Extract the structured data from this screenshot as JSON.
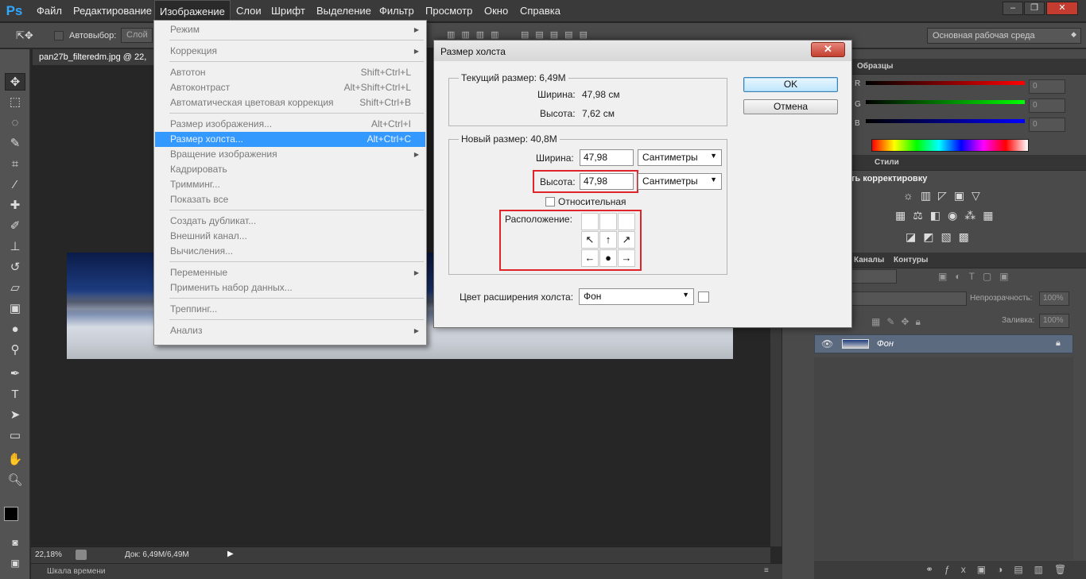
{
  "app": {
    "logo": "Ps"
  },
  "menubar": {
    "items": [
      "Файл",
      "Редактирование",
      "Изображение",
      "Слои",
      "Шрифт",
      "Выделение",
      "Фильтр",
      "Просмотр",
      "Окно",
      "Справка"
    ],
    "window_buttons": [
      "–",
      "❐",
      "✕"
    ]
  },
  "options_bar": {
    "auto_select_label": "Автовыбор:",
    "auto_select_value": "Слой",
    "workspace": "Основная рабочая среда"
  },
  "document": {
    "tab_title": "pan27b_filteredm.jpg @ 22,",
    "zoom": "22,18%",
    "doc_info": "Док: 6,49M/6,49M",
    "timeline_label": "Шкала времени"
  },
  "image_menu": {
    "items": [
      {
        "label": "Режим",
        "shortcut": "",
        "submenu": true
      },
      {
        "sep": true
      },
      {
        "label": "Коррекция",
        "shortcut": "",
        "submenu": true
      },
      {
        "sep": true
      },
      {
        "label": "Автотон",
        "shortcut": "Shift+Ctrl+L"
      },
      {
        "label": "Автоконтраст",
        "shortcut": "Alt+Shift+Ctrl+L"
      },
      {
        "label": "Автоматическая цветовая коррекция",
        "shortcut": "Shift+Ctrl+B"
      },
      {
        "sep": true
      },
      {
        "label": "Размер изображения...",
        "shortcut": "Alt+Ctrl+I"
      },
      {
        "label": "Размер холста...",
        "shortcut": "Alt+Ctrl+C",
        "highlighted": true
      },
      {
        "label": "Вращение изображения",
        "shortcut": "",
        "submenu": true
      },
      {
        "label": "Кадрировать",
        "shortcut": ""
      },
      {
        "label": "Тримминг...",
        "shortcut": ""
      },
      {
        "label": "Показать все",
        "shortcut": ""
      },
      {
        "sep": true
      },
      {
        "label": "Создать дубликат...",
        "shortcut": ""
      },
      {
        "label": "Внешний канал...",
        "shortcut": ""
      },
      {
        "label": "Вычисления...",
        "shortcut": ""
      },
      {
        "sep": true
      },
      {
        "label": "Переменные",
        "shortcut": "",
        "submenu": true
      },
      {
        "label": "Применить набор данных...",
        "shortcut": ""
      },
      {
        "sep": true
      },
      {
        "label": "Треппинг...",
        "shortcut": ""
      },
      {
        "sep": true
      },
      {
        "label": "Анализ",
        "shortcut": "",
        "submenu": true
      }
    ]
  },
  "dialog": {
    "title": "Размер холста",
    "close": "✕",
    "current_size_label": "Текущий размер:  6,49M",
    "current_width_label": "Ширина:",
    "current_width_value": "47,98 см",
    "current_height_label": "Высота:",
    "current_height_value": "7,62 см",
    "new_size_label": "Новый размер: 40,8M",
    "width_label": "Ширина:",
    "width_value": "47,98",
    "width_unit": "Сантиметры",
    "height_label": "Высота:",
    "height_value": "47,98",
    "height_unit": "Сантиметры",
    "relative_label": "Относительная",
    "anchor_label": "Расположение:",
    "anchor_cells": [
      "",
      "",
      "",
      "↖",
      "↑",
      "↗",
      "←",
      "●",
      "→"
    ],
    "extension_color_label": "Цвет расширения холста:",
    "extension_color_value": "Фон",
    "ok": "OK",
    "cancel": "Отмена"
  },
  "panels": {
    "swatches_tab": "Образцы",
    "rgb_labels": [
      "R",
      "G",
      "B"
    ],
    "rgb_values": [
      "0",
      "0",
      "0"
    ],
    "styles_tab": "Стили",
    "adjustments_title": "ть корректировку",
    "channels_tab": "Каналы",
    "paths_tab": "Контуры",
    "opacity_label": "Непрозрачность:",
    "opacity_value": "100%",
    "fill_label": "Заливка:",
    "fill_value": "100%",
    "layer_name": "Фон"
  },
  "colors": {
    "accent": "#3399ff",
    "highlight_frame": "#e0242a"
  }
}
